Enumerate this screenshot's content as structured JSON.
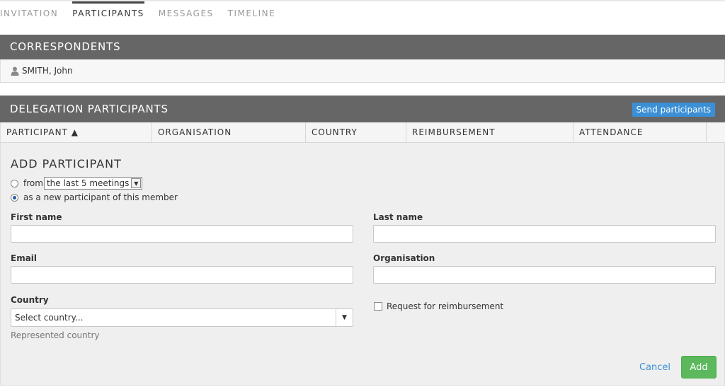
{
  "tabs": [
    {
      "label": "INVITATION",
      "active": false
    },
    {
      "label": "PARTICIPANTS",
      "active": true
    },
    {
      "label": "MESSAGES",
      "active": false
    },
    {
      "label": "TIMELINE",
      "active": false
    }
  ],
  "correspondents": {
    "title": "CORRESPONDENTS",
    "items": [
      {
        "name": "SMITH, John",
        "icon": "person-icon"
      }
    ]
  },
  "delegation": {
    "title": "DELEGATION PARTICIPANTS",
    "send_label": "Send participants",
    "columns": [
      {
        "label": "PARTICIPANT ▲",
        "sorted": "asc"
      },
      {
        "label": "ORGANISATION"
      },
      {
        "label": "COUNTRY"
      },
      {
        "label": "REIMBURSEMENT"
      },
      {
        "label": "ATTENDANCE"
      },
      {
        "label": ""
      }
    ]
  },
  "add_participant": {
    "title": "ADD PARTICIPANT",
    "option_from_label": "from",
    "option_from_value": "the last 5 meetings",
    "option_new_label": "as a new participant of this member",
    "selected_option": "new",
    "first_name_label": "First name",
    "last_name_label": "Last name",
    "email_label": "Email",
    "organisation_label": "Organisation",
    "country_label": "Country",
    "country_value": "Select country...",
    "country_hint": "Represented country",
    "reimbursement_label": "Request for reimbursement",
    "reimbursement_checked": false,
    "cancel_label": "Cancel",
    "add_label": "Add"
  },
  "colors": {
    "header_bg": "#666666",
    "send_button": "#3a8fd6",
    "add_button": "#5cb85c",
    "link": "#3a8fd6"
  }
}
